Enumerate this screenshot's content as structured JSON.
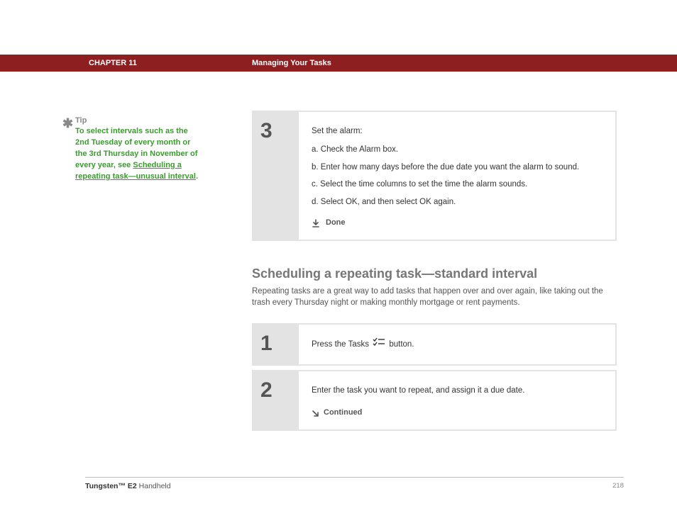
{
  "header": {
    "chapter": "CHAPTER 11",
    "title": "Managing Your Tasks"
  },
  "tip": {
    "label": "Tip",
    "text_before_link": "To select intervals such as the 2nd Tuesday of every month or the 3rd Thursday in November of every year, see ",
    "link_text": "Scheduling a repeating task—unusual interval",
    "after_link": "."
  },
  "step3": {
    "number": "3",
    "lead": "Set the alarm:",
    "a": "a.  Check the Alarm box.",
    "b": "b.  Enter how many days before the due date you want the alarm to sound.",
    "c": "c.  Select the time columns to set the time the alarm sounds.",
    "d": "d.  Select OK, and then select OK again.",
    "done": "Done"
  },
  "section": {
    "heading": "Scheduling a repeating task—standard interval",
    "intro": "Repeating tasks are a great way to add tasks that happen over and over again, like taking out the trash every Thursday night or making monthly mortgage or rent payments."
  },
  "step1": {
    "number": "1",
    "text_before_icon": "Press the Tasks ",
    "text_after_icon": " button."
  },
  "step2": {
    "number": "2",
    "text": "Enter the task you want to repeat, and assign it a due date.",
    "continued": "Continued"
  },
  "footer": {
    "product_bold": "Tungsten™ E2",
    "product_rest": " Handheld",
    "page": "218"
  }
}
